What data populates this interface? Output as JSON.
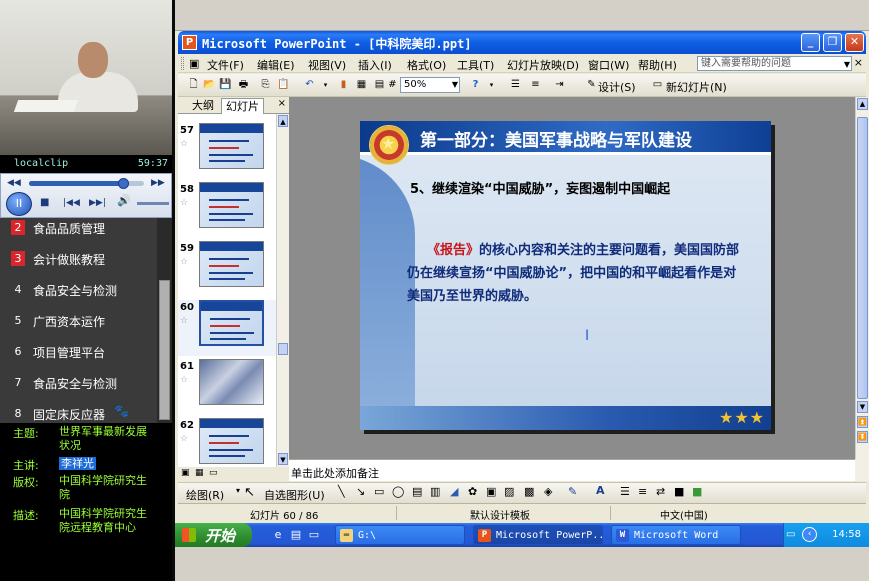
{
  "player": {
    "clip_name": "localclip",
    "clip_time": "59:37",
    "progress": 0.82,
    "controls": {
      "pause": "II",
      "stop": "■",
      "prev": "|◀◀",
      "next": "▶▶|",
      "volume": "🔊",
      "rewind": "◀◀",
      "forward": "▶▶"
    }
  },
  "course_list": [
    {
      "num": "2",
      "label": "食品品质管理",
      "highlight": true
    },
    {
      "num": "3",
      "label": "会计做账教程",
      "highlight": true
    },
    {
      "num": "4",
      "label": "食品安全与检测",
      "highlight": false
    },
    {
      "num": "5",
      "label": "广西资本运作",
      "highlight": false
    },
    {
      "num": "6",
      "label": "项目管理平台",
      "highlight": false
    },
    {
      "num": "7",
      "label": "食品安全与检测",
      "highlight": false
    },
    {
      "num": "8",
      "label": "固定床反应器",
      "highlight": false
    }
  ],
  "info": {
    "topic_key": "主题:",
    "topic_val": "世界军事最新发展状况",
    "lecturer_key": "主讲:",
    "lecturer_val": "李祥光",
    "copyright_key": "版权:",
    "copyright_val": "中国科学院研究生院",
    "desc_key": "描述:",
    "desc_val": "中国科学院研究生院远程教育中心"
  },
  "window": {
    "title": "Microsoft PowerPoint - [中科院美印.ppt]",
    "app_icon": "P"
  },
  "menubar": {
    "items": [
      "文件(F)",
      "编辑(E)",
      "视图(V)",
      "插入(I)",
      "格式(O)",
      "工具(T)",
      "幻灯片放映(D)",
      "窗口(W)",
      "帮助(H)"
    ],
    "help_placeholder": "键入需要帮助的问题"
  },
  "toolbar": {
    "zoom": "50%",
    "design_label": "设计(S)",
    "new_slide_label": "新幻灯片(N)"
  },
  "nav": {
    "tab_outline": "大纲",
    "tab_slides": "幻灯片",
    "close": "×",
    "slides": [
      {
        "num": "57",
        "kind": "text"
      },
      {
        "num": "58",
        "kind": "text"
      },
      {
        "num": "59",
        "kind": "text"
      },
      {
        "num": "60",
        "kind": "text",
        "selected": true
      },
      {
        "num": "61",
        "kind": "photo"
      },
      {
        "num": "62",
        "kind": "text"
      }
    ]
  },
  "slide": {
    "title": "第一部分：美国军事战略与军队建设",
    "heading": "5、继续渲染“中国威胁”，妄图遏制中国崛起",
    "body_highlight": "《报告》",
    "body_rest": "的核心内容和关注的主要问题看，美国国防部仍在继续宣扬“中国威胁论”，把中国的和平崛起看作是对美国乃至世界的威胁。",
    "stars": "★★★"
  },
  "notes_placeholder": "单击此处添加备注",
  "drawbar": {
    "draw_label": "绘图(R)",
    "autoshapes_label": "自选图形(U)"
  },
  "status": {
    "slide_pos": "幻灯片 60 / 86",
    "design": "默认设计模板",
    "lang": "中文(中国)"
  },
  "taskbar": {
    "start": "开始",
    "folder_task": "G:\\",
    "ppt_task": "Microsoft PowerP...",
    "word_task": "Microsoft Word",
    "clock": "14:58"
  },
  "colors": {
    "accent_blue": "#0b4fd1",
    "slide_title_band": "#0b3a8b",
    "body_text": "#102b7a",
    "highlight_red": "#c8151b",
    "info_green": "#9cff33"
  }
}
